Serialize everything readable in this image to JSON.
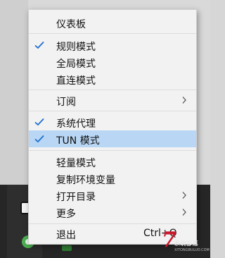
{
  "menu": {
    "items": [
      {
        "label": "仪表板",
        "checked": false,
        "submenu": false
      },
      {
        "label": "规则模式",
        "checked": true,
        "submenu": false
      },
      {
        "label": "全局模式",
        "checked": false,
        "submenu": false
      },
      {
        "label": "直连模式",
        "checked": false,
        "submenu": false
      },
      {
        "label": "订阅",
        "checked": false,
        "submenu": true
      },
      {
        "label": "系统代理",
        "checked": true,
        "submenu": false
      },
      {
        "label": "TUN 模式",
        "checked": true,
        "submenu": false,
        "highlighted": true
      },
      {
        "label": "轻量模式",
        "checked": false,
        "submenu": false
      },
      {
        "label": "复制环境变量",
        "checked": false,
        "submenu": false
      },
      {
        "label": "打开目录",
        "checked": false,
        "submenu": true
      },
      {
        "label": "更多",
        "checked": false,
        "submenu": true
      },
      {
        "label": "退出",
        "checked": false,
        "submenu": false,
        "shortcut": "Ctrl+Q"
      }
    ]
  },
  "colors": {
    "check": "#1f6fd1",
    "highlight": "#b9d7f5",
    "menu_bg": "#f2f2f2"
  },
  "watermark": {
    "mark": "7",
    "text": "系统部落",
    "sub": "XITONGBULUO.COM"
  }
}
